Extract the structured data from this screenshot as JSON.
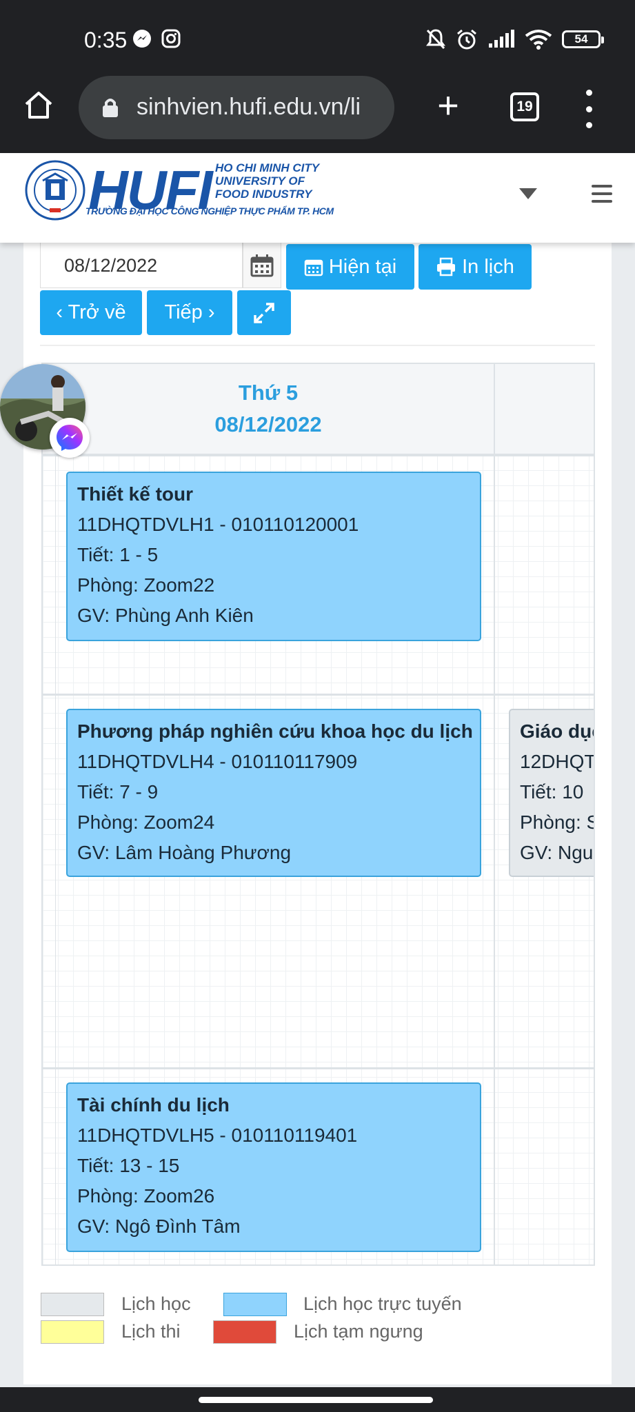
{
  "status_bar": {
    "time": "0:35",
    "battery": "54"
  },
  "browser": {
    "url": "sinhvien.hufi.edu.vn/li",
    "tab_count": "19"
  },
  "site": {
    "logo_text": "HUFI",
    "logo_line1": "HO CHI MINH CITY",
    "logo_line2": "UNIVERSITY OF",
    "logo_line3": "FOOD INDUSTRY",
    "logo_vn": "TRƯỜNG ĐẠI HỌC CÔNG NGHIỆP THỰC PHẨM TP. HCM"
  },
  "toolbar": {
    "date_value": "08/12/2022",
    "now_label": "Hiện tại",
    "print_label": "In lịch",
    "back_label": "‹ Trở về",
    "next_label": "Tiếp ›"
  },
  "schedule": {
    "day_name": "Thứ 5",
    "day_date": "08/12/2022",
    "events": [
      {
        "title": "Thiết kế tour",
        "code": "11DHQTDVLH1 - 010110120001",
        "period": "Tiết: 1 - 5",
        "room": "Phòng: Zoom22",
        "teacher": "GV: Phùng Anh Kiên"
      },
      {
        "title": "Phương pháp nghiên cứu khoa học du lịch",
        "code": "11DHQTDVLH4 - 010110117909",
        "period": "Tiết: 7 - 9",
        "room": "Phòng: Zoom24",
        "teacher": "GV: Lâm Hoàng Phương"
      },
      {
        "title": "Tài chính du lịch",
        "code": "11DHQTDVLH5 - 010110119401",
        "period": "Tiết: 13 - 15",
        "room": "Phòng: Zoom26",
        "teacher": "GV: Ngô Đình Tâm"
      }
    ],
    "next_column_event": {
      "title": "Giáo dục",
      "code": "12DHQT",
      "period": "Tiết: 10",
      "room": "Phòng: S",
      "teacher": "GV: Ngu"
    }
  },
  "legend": {
    "regular": "Lịch học",
    "online": "Lịch học trực tuyến",
    "exam": "Lịch thi",
    "suspended": "Lịch tạm ngưng"
  },
  "colors": {
    "online": "#8fd3fd",
    "regular": "#e5e9ec",
    "exam": "#ffff99",
    "suspended": "#e04a3a",
    "button": "#1ea7f0",
    "brand": "#1a55a8"
  }
}
